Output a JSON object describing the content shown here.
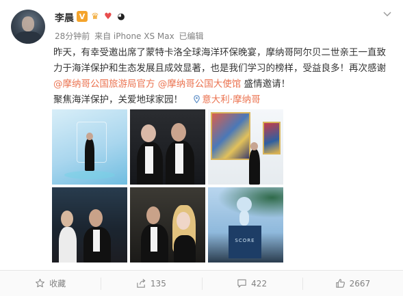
{
  "post": {
    "author": "李晨",
    "meta_time": "28分钟前",
    "meta_source": "来自 iPhone XS Max",
    "meta_edited": "已编辑",
    "text_before": "昨天，有幸受邀出席了蒙特卡洛全球海洋环保晚宴，摩纳哥阿尔贝二世亲王一直致力于海洋保护和生态发展且成效显著，也是我们学习的榜样，受益良多！再次感谢",
    "mention_1": "@摩纳哥公国旅游局官方",
    "mention_2": "@摩纳哥公国大使馆",
    "text_after": " 盛情邀请！",
    "line_2": "聚焦海洋保护，关爱地球家园！",
    "location": "意大利·摩纳哥"
  },
  "footer": {
    "favorite_label": "收藏",
    "repost_count": "135",
    "comment_count": "422",
    "like_count": "2667"
  },
  "colors": {
    "badge_v": "#f4a42c",
    "link": "#eb7350",
    "location": "#5d8ec6"
  },
  "photos": {
    "photo_6_sign": "SCORE"
  }
}
